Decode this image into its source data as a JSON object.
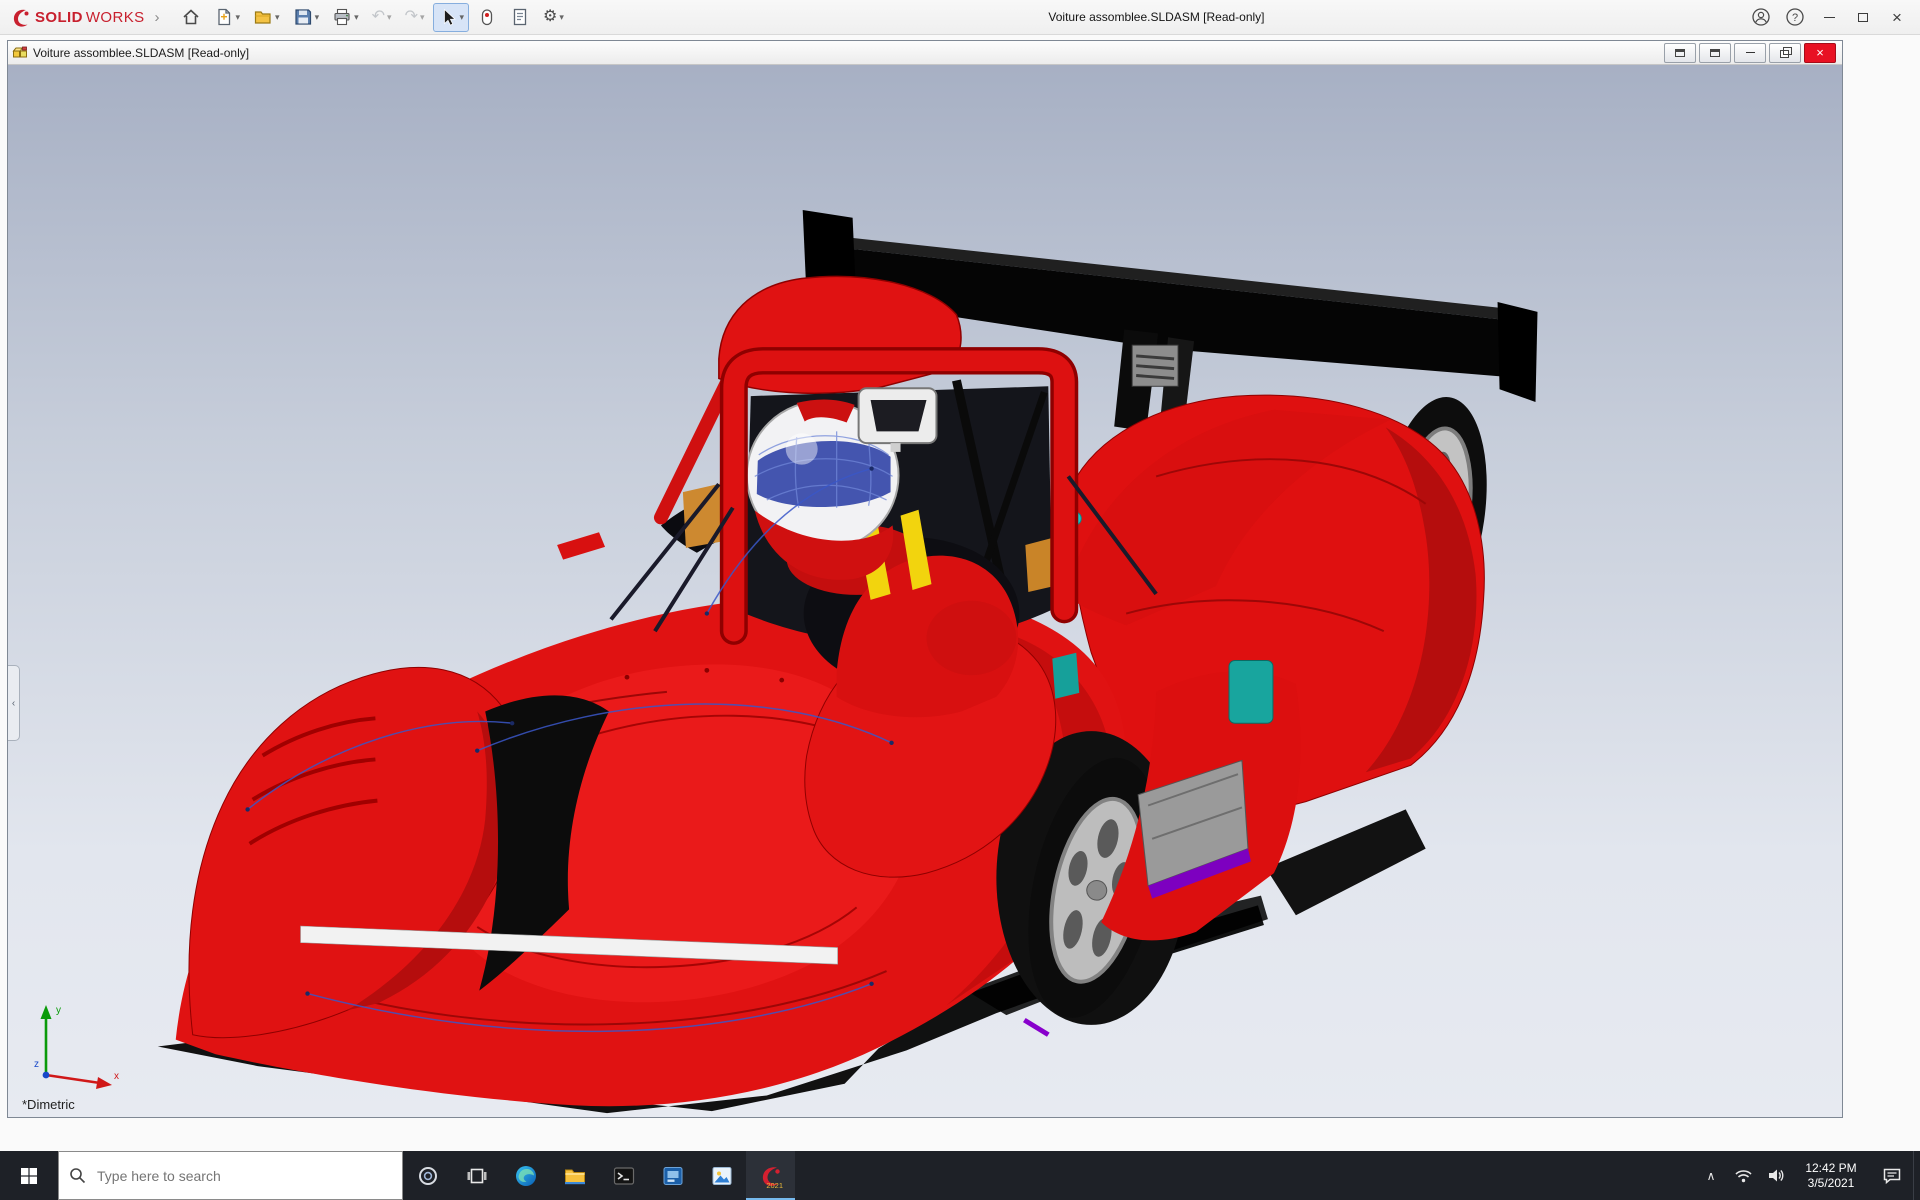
{
  "glyphs": {
    "flyout_arrow": "›",
    "dropdown": "▾",
    "undo": "↶",
    "redo": "↷",
    "gear": "⚙",
    "help": "?",
    "close": "×",
    "tray_chevron": "∧",
    "panel_collapse": "‹"
  },
  "app_titlebar": {
    "brand": {
      "solid": "SOLID",
      "works": "WORKS"
    },
    "title": "Voiture assomblee.SLDASM [Read-only]"
  },
  "document_window": {
    "title": "Voiture assomblee.SLDASM [Read-only]",
    "view_label": "*Dimetric",
    "triad": {
      "x": "x",
      "y": "y",
      "z": "z"
    }
  },
  "taskbar": {
    "search_placeholder": "Type here to search",
    "clock_time": "12:42 PM",
    "clock_date": "3/5/2021",
    "solidworks_badge": "2021"
  },
  "colors": {
    "solidworks_red": "#c8202e",
    "car_red": "#e01212",
    "viewport_gradient_top": "#a7b0c4",
    "viewport_gradient_bottom": "#e7eaf1",
    "taskbar_bg": "#1e2127",
    "doc_close_red": "#e81123",
    "active_tool_bg": "#d7e4f7"
  }
}
